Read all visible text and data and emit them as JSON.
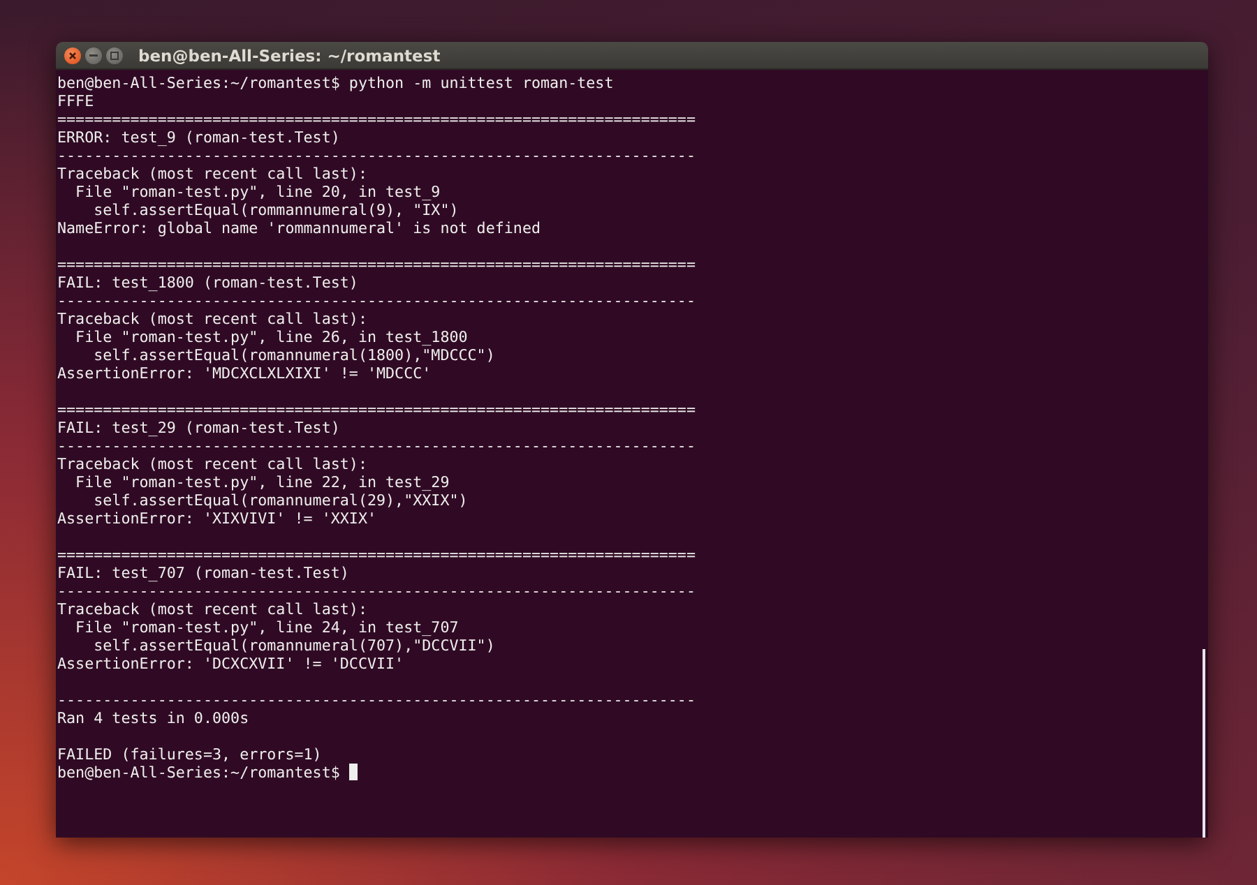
{
  "window": {
    "title": "ben@ben-All-Series: ~/romantest"
  },
  "terminal": {
    "cursor": true,
    "blocks": [
      [
        "ben@ben-All-Series:~/romantest$ python -m unittest roman-test",
        "FFFE",
        "======================================================================",
        "ERROR: test_9 (roman-test.Test)",
        "----------------------------------------------------------------------",
        "Traceback (most recent call last):",
        "  File \"roman-test.py\", line 20, in test_9",
        "    self.assertEqual(rommannumeral(9), \"IX\")",
        "NameError: global name 'rommannumeral' is not defined"
      ],
      [
        "======================================================================",
        "FAIL: test_1800 (roman-test.Test)",
        "----------------------------------------------------------------------",
        "Traceback (most recent call last):",
        "  File \"roman-test.py\", line 26, in test_1800",
        "    self.assertEqual(romannumeral(1800),\"MDCCC\")",
        "AssertionError: 'MDCXCLXLXIXI' != 'MDCCC'"
      ],
      [
        "======================================================================",
        "FAIL: test_29 (roman-test.Test)",
        "----------------------------------------------------------------------",
        "Traceback (most recent call last):",
        "  File \"roman-test.py\", line 22, in test_29",
        "    self.assertEqual(romannumeral(29),\"XXIX\")",
        "AssertionError: 'XIXVIVI' != 'XXIX'"
      ],
      [
        "======================================================================",
        "FAIL: test_707 (roman-test.Test)",
        "----------------------------------------------------------------------",
        "Traceback (most recent call last):",
        "  File \"roman-test.py\", line 24, in test_707",
        "    self.assertEqual(romannumeral(707),\"DCCVII\")",
        "AssertionError: 'DCXCXVII' != 'DCCVII'"
      ],
      [
        "----------------------------------------------------------------------",
        "Ran 4 tests in 0.000s"
      ],
      [
        "FAILED (failures=3, errors=1)",
        "ben@ben-All-Series:~/romantest$ "
      ]
    ]
  }
}
